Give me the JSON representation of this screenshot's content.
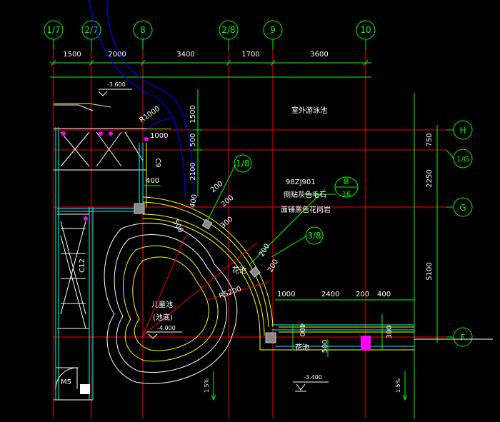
{
  "grid_top": {
    "labels": [
      "1/7",
      "2/7",
      "8",
      "2/8",
      "9",
      "10"
    ],
    "spacings": [
      "1500",
      "2000",
      "3400",
      "1700",
      "3600"
    ]
  },
  "grid_right": {
    "labels": [
      "H",
      "1/G",
      "G",
      "F"
    ],
    "spacings": [
      "750",
      "2250",
      "5100"
    ]
  },
  "rooms": {
    "pool": "室外游泳池",
    "kids_pool": "儿童池",
    "kids_pool_note": "(池底)",
    "planter_a": "花池",
    "planter_b": "花池"
  },
  "notes": {
    "ref_code": "98ZJ901",
    "wall_line1": "侧贴灰色毛石",
    "wall_line2": "面铺黑色花岗岩",
    "detail_letter": "B",
    "detail_number": "16",
    "section_1": "1/8",
    "section_2": "3/8"
  },
  "levels": {
    "top": "-3.600",
    "pool_bottom": "-4.000",
    "bottom": "-3.400"
  },
  "dims": {
    "d1500": "1500",
    "d500": "500",
    "d2100": "2100",
    "d1000a": "1000",
    "c9": "C9",
    "d400a": "400",
    "d400b": "400",
    "d200a": "200",
    "d200b": "200",
    "d300": "300",
    "d500b": "500",
    "d200c": "200",
    "d200d": "200",
    "d1000b": "1000",
    "d2400": "2400",
    "d200e": "200",
    "d400c": "400",
    "d400d": "400",
    "d300b": "300",
    "d500c": "500",
    "r1000": "R1000",
    "r5200": "R5200",
    "c12": "C12",
    "m5": "M5",
    "slope_l": "1.5%",
    "slope_r": "1.5%"
  },
  "colors": {
    "background": "#000000",
    "grid": "#ff0000",
    "dim_line": "#00ff00",
    "bubble": "#00ff00",
    "wall": "#ffff00",
    "wall_alt": "#00ffff",
    "pipe": "#0000ff",
    "accent": "#ff00ff"
  }
}
